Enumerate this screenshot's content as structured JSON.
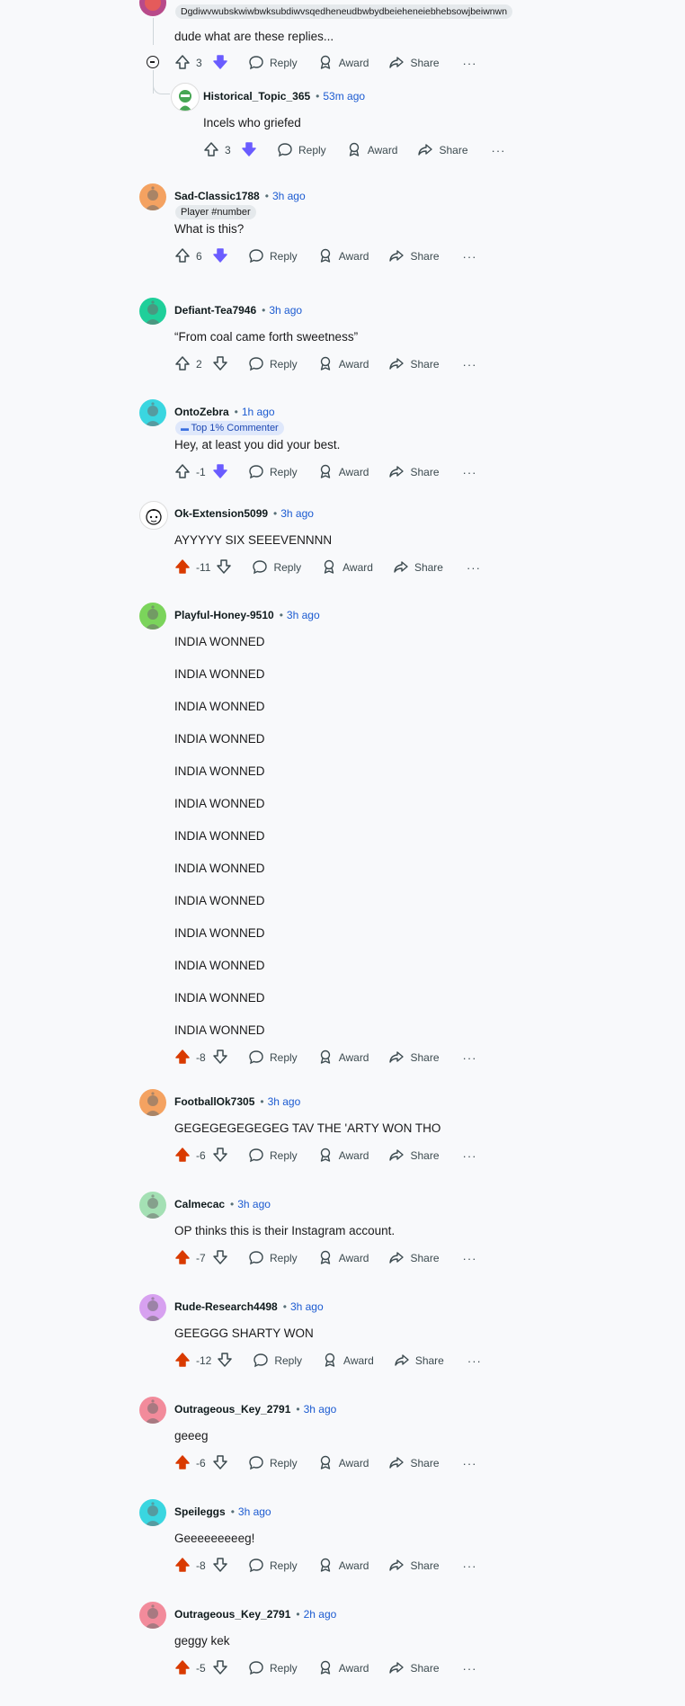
{
  "labels": {
    "reply": "Reply",
    "award": "Award",
    "share": "Share",
    "more": "···",
    "sep": "•"
  },
  "colors": {
    "upvote_active": "#d93a00",
    "downvote_active": "#6a5cff",
    "time_link": "#1c5bd1"
  },
  "top_partial": {
    "flair": "Dgdiwvwubskwiwbwksubdiwvsqedheneudbwbydbeieheneiebhebsowjbeiwnwn",
    "body": "dude what are these replies...",
    "score": "3",
    "vote": "down"
  },
  "nested_reply": {
    "username": "Historical_Topic_365",
    "time": "53m ago",
    "body": "Incels who griefed",
    "score": "3",
    "vote": "down"
  },
  "comments": [
    {
      "username": "Sad-Classic1788",
      "time": "3h ago",
      "flair": "Player #number",
      "body": [
        "What is this?"
      ],
      "score": "6",
      "vote": "down",
      "avatar": "orange"
    },
    {
      "username": "Defiant-Tea7946",
      "time": "3h ago",
      "body": [
        "“From coal came forth sweetness”"
      ],
      "score": "2",
      "vote": "none",
      "avatar": "teal"
    },
    {
      "username": "OntoZebra",
      "time": "1h ago",
      "flair": "Top 1% Commenter",
      "body": [
        "Hey, at least you did your best."
      ],
      "score": "-1",
      "vote": "down",
      "avatar": "cyan"
    },
    {
      "username": "Ok-Extension5099",
      "time": "3h ago",
      "body": [
        "AYYYYY SIX SEEEVENNNN"
      ],
      "score": "-11",
      "vote": "up",
      "avatar": "custom"
    },
    {
      "username": "Playful-Honey-9510",
      "time": "3h ago",
      "body": [
        "INDIA WONNED",
        "INDIA WONNED",
        "INDIA WONNED",
        "INDIA WONNED",
        "INDIA WONNED",
        "INDIA WONNED",
        "INDIA WONNED",
        "INDIA WONNED",
        "INDIA WONNED",
        "INDIA WONNED",
        "INDIA WONNED",
        "INDIA WONNED",
        "INDIA WONNED"
      ],
      "score": "-8",
      "vote": "up",
      "avatar": "green"
    },
    {
      "username": "FootballOk7305",
      "time": "3h ago",
      "body": [
        "GEGEGEGEGEGEG TAV THE 'ARTY WON THO"
      ],
      "score": "-6",
      "vote": "up",
      "avatar": "orange"
    },
    {
      "username": "Calmecac",
      "time": "3h ago",
      "body": [
        "OP thinks this is their Instagram account."
      ],
      "score": "-7",
      "vote": "up",
      "avatar": "lightgreen"
    },
    {
      "username": "Rude-Research4498",
      "time": "3h ago",
      "body": [
        "GEEGGG SHARTY WON"
      ],
      "score": "-12",
      "vote": "up",
      "avatar": "purple"
    },
    {
      "username": "Outrageous_Key_2791",
      "time": "3h ago",
      "body": [
        "geeeg"
      ],
      "score": "-6",
      "vote": "up",
      "avatar": "pink"
    },
    {
      "username": "Speileggs",
      "time": "3h ago",
      "body": [
        "Geeeeeeeeeg!"
      ],
      "score": "-8",
      "vote": "up",
      "avatar": "cyan"
    },
    {
      "username": "Outrageous_Key_2791",
      "time": "2h ago",
      "body": [
        "geggy kek"
      ],
      "score": "-5",
      "vote": "up",
      "avatar": "pink"
    }
  ]
}
